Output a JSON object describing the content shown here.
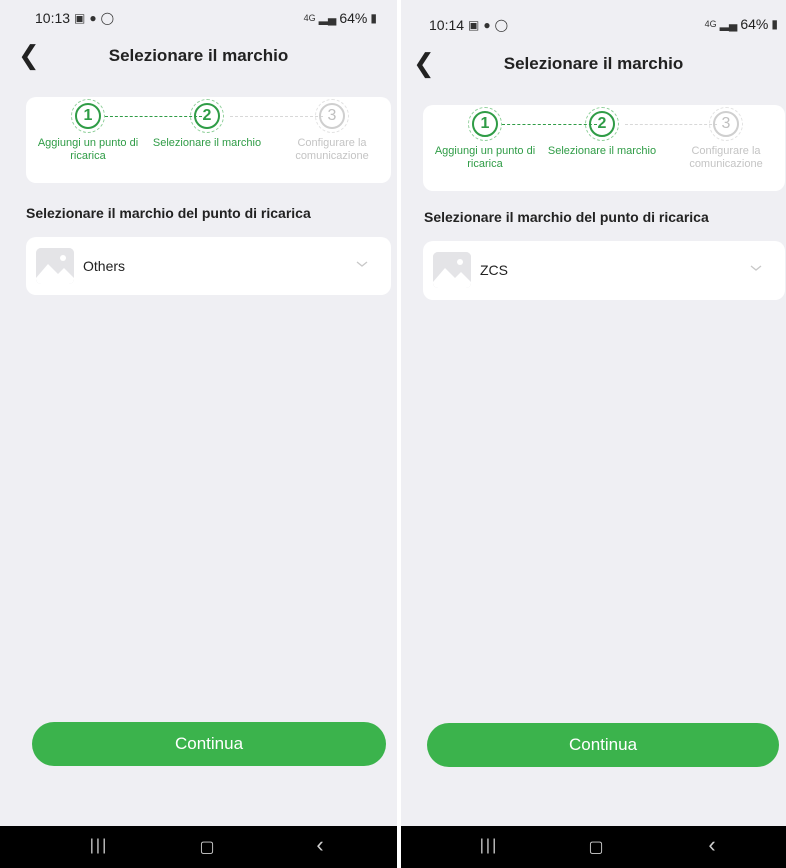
{
  "screens": [
    {
      "status": {
        "time": "10:13",
        "signal": "4G",
        "battery": "64%"
      },
      "title": "Selezionare il marchio",
      "steps": [
        {
          "number": "1",
          "label": "Aggiungi un punto di ricarica",
          "state": "done"
        },
        {
          "number": "2",
          "label": "Selezionare il marchio",
          "state": "active"
        },
        {
          "number": "3",
          "label": "Configurare la comunicazione",
          "state": "pending"
        }
      ],
      "section_label": "Selezionare il marchio del punto di ricarica",
      "brand_selected": "Others",
      "continue_label": "Continua"
    },
    {
      "status": {
        "time": "10:14",
        "signal": "4G",
        "battery": "64%"
      },
      "title": "Selezionare il marchio",
      "steps": [
        {
          "number": "1",
          "label": "Aggiungi un punto di ricarica",
          "state": "done"
        },
        {
          "number": "2",
          "label": "Selezionare il marchio",
          "state": "active"
        },
        {
          "number": "3",
          "label": "Configurare la comunicazione",
          "state": "pending"
        }
      ],
      "section_label": "Selezionare il marchio del punto di ricarica",
      "brand_selected": "ZCS",
      "continue_label": "Continua"
    }
  ],
  "colors": {
    "accent": "#3bb34c",
    "step_green": "#2f9c46",
    "pending": "#c4c4c4",
    "background": "#efeff3"
  },
  "icons": [
    "back-arrow-icon",
    "gallery-icon",
    "whatsapp-icon",
    "b-badge-icon",
    "signal-icon",
    "battery-icon",
    "image-placeholder-icon",
    "chevron-down-icon",
    "recent-apps-icon",
    "home-icon",
    "nav-back-icon"
  ]
}
